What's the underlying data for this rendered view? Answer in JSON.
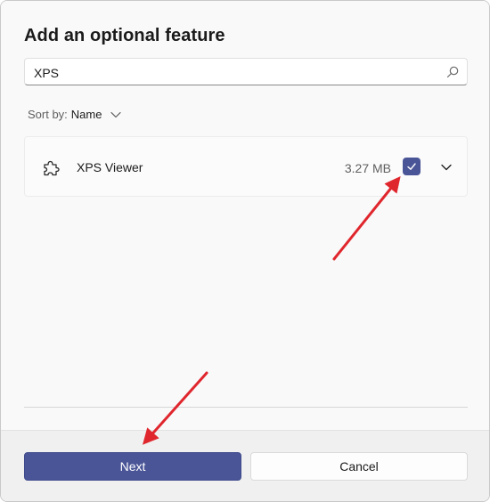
{
  "dialog": {
    "title": "Add an optional feature"
  },
  "search": {
    "value": "XPS",
    "icon": "search-icon"
  },
  "sort": {
    "label": "Sort by:",
    "value": "Name"
  },
  "features": [
    {
      "name": "XPS Viewer",
      "size": "3.27 MB",
      "checked": true,
      "icon": "puzzle-piece-icon"
    }
  ],
  "footer": {
    "next_label": "Next",
    "cancel_label": "Cancel"
  },
  "colors": {
    "accent": "#4a5598",
    "annotation_arrow": "#e0262d"
  }
}
